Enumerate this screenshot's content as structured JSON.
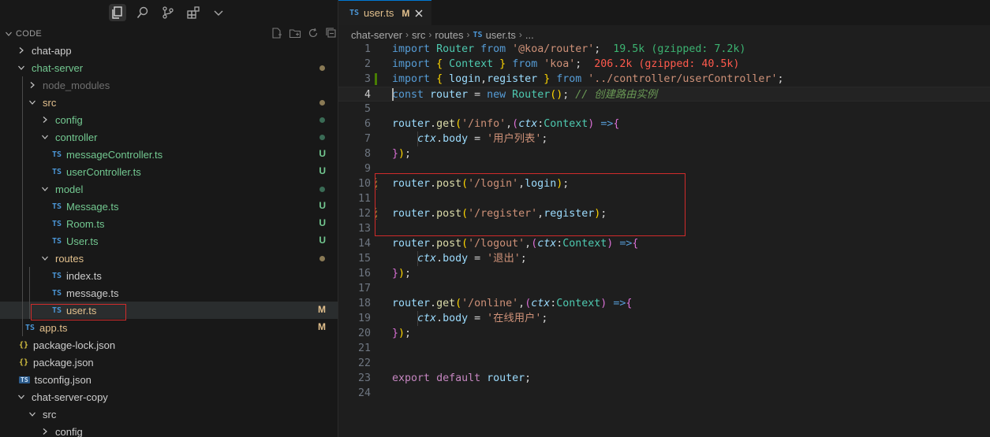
{
  "sidebar": {
    "section_title": "CODE",
    "tree": [
      {
        "label": "chat-app",
        "kind": "folder",
        "open": false,
        "depth": 0,
        "status": ""
      },
      {
        "label": "chat-server",
        "kind": "folder",
        "open": true,
        "depth": 0,
        "status": "mod-dot"
      },
      {
        "label": "node_modules",
        "kind": "folder",
        "open": false,
        "depth": 1,
        "status": "",
        "dim": true
      },
      {
        "label": "src",
        "kind": "folder",
        "open": true,
        "depth": 1,
        "status": "mod-dot"
      },
      {
        "label": "config",
        "kind": "folder",
        "open": false,
        "depth": 2,
        "status": "unt-dot"
      },
      {
        "label": "controller",
        "kind": "folder",
        "open": true,
        "depth": 2,
        "status": "unt-dot"
      },
      {
        "label": "messageController.ts",
        "kind": "ts",
        "depth": 3,
        "status": "U"
      },
      {
        "label": "userController.ts",
        "kind": "ts",
        "depth": 3,
        "status": "U"
      },
      {
        "label": "model",
        "kind": "folder",
        "open": true,
        "depth": 2,
        "status": "unt-dot"
      },
      {
        "label": "Message.ts",
        "kind": "ts",
        "depth": 3,
        "status": "U"
      },
      {
        "label": "Room.ts",
        "kind": "ts",
        "depth": 3,
        "status": "U"
      },
      {
        "label": "User.ts",
        "kind": "ts",
        "depth": 3,
        "status": "U"
      },
      {
        "label": "routes",
        "kind": "folder",
        "open": true,
        "depth": 2,
        "status": "mod-dot"
      },
      {
        "label": "index.ts",
        "kind": "ts",
        "depth": 3,
        "status": ""
      },
      {
        "label": "message.ts",
        "kind": "ts",
        "depth": 3,
        "status": ""
      },
      {
        "label": "user.ts",
        "kind": "ts",
        "depth": 3,
        "status": "M",
        "selected": true
      },
      {
        "label": "app.ts",
        "kind": "ts",
        "depth": 2,
        "status": "M"
      },
      {
        "label": "package-lock.json",
        "kind": "json",
        "depth": 1,
        "status": ""
      },
      {
        "label": "package.json",
        "kind": "json",
        "depth": 1,
        "status": ""
      },
      {
        "label": "tsconfig.json",
        "kind": "tscfg",
        "depth": 1,
        "status": ""
      },
      {
        "label": "chat-server-copy",
        "kind": "folder",
        "open": true,
        "depth": 0,
        "status": ""
      },
      {
        "label": "src",
        "kind": "folder",
        "open": true,
        "depth": 1,
        "status": ""
      },
      {
        "label": "config",
        "kind": "folder",
        "open": false,
        "depth": 2,
        "status": ""
      }
    ]
  },
  "editor": {
    "tab": {
      "icon": "TS",
      "name": "user.ts",
      "status": "M"
    },
    "breadcrumbs": [
      "chat-server",
      "src",
      "routes",
      "user.ts",
      "..."
    ],
    "breadcrumb_icon": "TS",
    "lines": [
      {
        "n": "1",
        "mark": "",
        "tokens": [
          [
            "k",
            "import"
          ],
          [
            "p",
            " "
          ],
          [
            "t",
            "Router"
          ],
          [
            "p",
            " "
          ],
          [
            "k",
            "from"
          ],
          [
            "p",
            " "
          ],
          [
            "s",
            "'@koa/router'"
          ],
          [
            "p",
            ";  "
          ],
          [
            "sz1",
            "19.5k (gzipped: 7.2k)"
          ]
        ]
      },
      {
        "n": "2",
        "mark": "",
        "tokens": [
          [
            "k",
            "import"
          ],
          [
            "p",
            " "
          ],
          [
            "b1",
            "{"
          ],
          [
            "p",
            " "
          ],
          [
            "t",
            "Context"
          ],
          [
            "p",
            " "
          ],
          [
            "b1",
            "}"
          ],
          [
            "p",
            " "
          ],
          [
            "k",
            "from"
          ],
          [
            "p",
            " "
          ],
          [
            "s",
            "'koa'"
          ],
          [
            "p",
            ";  "
          ],
          [
            "sz2",
            "206.2k (gzipped: 40.5k)"
          ]
        ]
      },
      {
        "n": "3",
        "mark": "add",
        "tokens": [
          [
            "k",
            "import"
          ],
          [
            "p",
            " "
          ],
          [
            "b1",
            "{"
          ],
          [
            "p",
            " "
          ],
          [
            "v",
            "login"
          ],
          [
            "p",
            ","
          ],
          [
            "v",
            "register"
          ],
          [
            "p",
            " "
          ],
          [
            "b1",
            "}"
          ],
          [
            "p",
            " "
          ],
          [
            "k",
            "from"
          ],
          [
            "p",
            " "
          ],
          [
            "s",
            "'../controller/userController'"
          ],
          [
            "p",
            ";"
          ]
        ]
      },
      {
        "n": "4",
        "mark": "",
        "current": true,
        "tokens": [
          [
            "k",
            "const"
          ],
          [
            "p",
            " "
          ],
          [
            "v",
            "router"
          ],
          [
            "p",
            " = "
          ],
          [
            "k",
            "new"
          ],
          [
            "p",
            " "
          ],
          [
            "t",
            "Router"
          ],
          [
            "b1",
            "()"
          ],
          [
            "p",
            "; "
          ],
          [
            "c",
            "// 创建路由实例"
          ]
        ]
      },
      {
        "n": "5",
        "mark": "",
        "tokens": []
      },
      {
        "n": "6",
        "mark": "",
        "tokens": [
          [
            "v",
            "router"
          ],
          [
            "p",
            "."
          ],
          [
            "f",
            "get"
          ],
          [
            "b1",
            "("
          ],
          [
            "s",
            "'/info'"
          ],
          [
            "p",
            ","
          ],
          [
            "b2",
            "("
          ],
          [
            "vi",
            "ctx"
          ],
          [
            "p",
            ":"
          ],
          [
            "t",
            "Context"
          ],
          [
            "b2",
            ")"
          ],
          [
            "p",
            " "
          ],
          [
            "k",
            "=>"
          ],
          [
            "b2",
            "{"
          ]
        ]
      },
      {
        "n": "7",
        "mark": "",
        "tokens": [
          [
            "p",
            "    "
          ],
          [
            "vi",
            "ctx"
          ],
          [
            "p",
            "."
          ],
          [
            "v",
            "body"
          ],
          [
            "p",
            " = "
          ],
          [
            "s",
            "'用户列表'"
          ],
          [
            "p",
            ";"
          ]
        ]
      },
      {
        "n": "8",
        "mark": "",
        "tokens": [
          [
            "b2",
            "}"
          ],
          [
            "b1",
            ")"
          ],
          [
            "p",
            ";"
          ]
        ]
      },
      {
        "n": "9",
        "mark": "",
        "tokens": []
      },
      {
        "n": "10",
        "mark": "chg",
        "tokens": [
          [
            "v",
            "router"
          ],
          [
            "p",
            "."
          ],
          [
            "f",
            "post"
          ],
          [
            "b1",
            "("
          ],
          [
            "s",
            "'/login'"
          ],
          [
            "p",
            ","
          ],
          [
            "v",
            "login"
          ],
          [
            "b1",
            ")"
          ],
          [
            "p",
            ";"
          ]
        ]
      },
      {
        "n": "11",
        "mark": "",
        "tokens": []
      },
      {
        "n": "12",
        "mark": "chg",
        "tokens": [
          [
            "v",
            "router"
          ],
          [
            "p",
            "."
          ],
          [
            "f",
            "post"
          ],
          [
            "b1",
            "("
          ],
          [
            "s",
            "'/register'"
          ],
          [
            "p",
            ","
          ],
          [
            "v",
            "register"
          ],
          [
            "b1",
            ")"
          ],
          [
            "p",
            ";"
          ]
        ]
      },
      {
        "n": "13",
        "mark": "",
        "tokens": []
      },
      {
        "n": "14",
        "mark": "",
        "tokens": [
          [
            "v",
            "router"
          ],
          [
            "p",
            "."
          ],
          [
            "f",
            "post"
          ],
          [
            "b1",
            "("
          ],
          [
            "s",
            "'/logout'"
          ],
          [
            "p",
            ","
          ],
          [
            "b2",
            "("
          ],
          [
            "vi",
            "ctx"
          ],
          [
            "p",
            ":"
          ],
          [
            "t",
            "Context"
          ],
          [
            "b2",
            ")"
          ],
          [
            "p",
            " "
          ],
          [
            "k",
            "=>"
          ],
          [
            "b2",
            "{"
          ]
        ]
      },
      {
        "n": "15",
        "mark": "",
        "tokens": [
          [
            "p",
            "    "
          ],
          [
            "vi",
            "ctx"
          ],
          [
            "p",
            "."
          ],
          [
            "v",
            "body"
          ],
          [
            "p",
            " = "
          ],
          [
            "s",
            "'退出'"
          ],
          [
            "p",
            ";"
          ]
        ]
      },
      {
        "n": "16",
        "mark": "",
        "tokens": [
          [
            "b2",
            "}"
          ],
          [
            "b1",
            ")"
          ],
          [
            "p",
            ";"
          ]
        ]
      },
      {
        "n": "17",
        "mark": "",
        "tokens": []
      },
      {
        "n": "18",
        "mark": "",
        "tokens": [
          [
            "v",
            "router"
          ],
          [
            "p",
            "."
          ],
          [
            "f",
            "get"
          ],
          [
            "b1",
            "("
          ],
          [
            "s",
            "'/online'"
          ],
          [
            "p",
            ","
          ],
          [
            "b2",
            "("
          ],
          [
            "vi",
            "ctx"
          ],
          [
            "p",
            ":"
          ],
          [
            "t",
            "Context"
          ],
          [
            "b2",
            ")"
          ],
          [
            "p",
            " "
          ],
          [
            "k",
            "=>"
          ],
          [
            "b2",
            "{"
          ]
        ]
      },
      {
        "n": "19",
        "mark": "",
        "tokens": [
          [
            "p",
            "    "
          ],
          [
            "vi",
            "ctx"
          ],
          [
            "p",
            "."
          ],
          [
            "v",
            "body"
          ],
          [
            "p",
            " = "
          ],
          [
            "s",
            "'在线用户'"
          ],
          [
            "p",
            ";"
          ]
        ]
      },
      {
        "n": "20",
        "mark": "",
        "tokens": [
          [
            "b2",
            "}"
          ],
          [
            "b1",
            ")"
          ],
          [
            "p",
            ";"
          ]
        ]
      },
      {
        "n": "21",
        "mark": "",
        "tokens": []
      },
      {
        "n": "22",
        "mark": "",
        "tokens": []
      },
      {
        "n": "23",
        "mark": "",
        "tokens": [
          [
            "kp",
            "export"
          ],
          [
            "p",
            " "
          ],
          [
            "kp",
            "default"
          ],
          [
            "p",
            " "
          ],
          [
            "v",
            "router"
          ],
          [
            "p",
            ";"
          ]
        ]
      },
      {
        "n": "24",
        "mark": "",
        "tokens": []
      }
    ]
  },
  "icons": {
    "explorer": "files-icon",
    "search": "search-icon",
    "scm": "source-control-icon",
    "extensions": "extensions-icon",
    "more": "chevron-down-icon"
  },
  "colors": {
    "accent": "#0078d4",
    "modified": "#e2c08d",
    "untracked": "#73c991",
    "highlight_box": "#d12b2b"
  }
}
